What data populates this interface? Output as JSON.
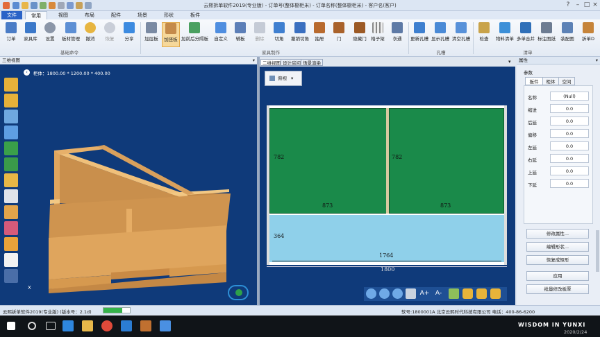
{
  "title": "云熙拆单软件2019(专业版) - 订单号(整体橱柜米) - 订单名称(整体橱柜米) - 客户名(客户)",
  "menu": {
    "tabs": [
      "文件",
      "常用",
      "视图",
      "布局",
      "配件",
      "场景",
      "形状",
      "板件"
    ]
  },
  "ribbon": {
    "buttons": [
      "订单",
      "家具库",
      "设置",
      "板材管理",
      "撤消",
      "恢复",
      "分享",
      "加层板",
      "加竖板",
      "加前后分隔板",
      "自定义",
      "辅板",
      "删除",
      "切角",
      "撤销切角",
      "抽屉",
      "门",
      "隐藏门",
      "格子架",
      "衣通",
      "更新孔槽",
      "显示孔槽",
      "清空孔槽",
      "检查",
      "物料清单",
      "多单合并",
      "标注图纸",
      "装配图",
      "拆单D"
    ],
    "groups": [
      "基础命令",
      "家具制作",
      "孔槽",
      "清单"
    ]
  },
  "panel3d": {
    "title": "三维视图",
    "cabinet_info": "柜体：1800.00 * 1200.00 * 400.00",
    "axis_x": "X"
  },
  "panel2d": {
    "tabs": [
      "二维视图",
      "设计房间",
      "场景渲染"
    ],
    "view_mode": "俯视",
    "dims": {
      "left_height": "782",
      "right_height": "782",
      "left_width": "873",
      "right_width": "873",
      "bottom_height": "364",
      "inner_width": "1764",
      "total_width": "1800"
    }
  },
  "props": {
    "title": "属性",
    "section": "参数",
    "tabs": [
      "板件",
      "柜体",
      "空间"
    ],
    "fields": [
      {
        "label": "名称",
        "value": "(Null)"
      },
      {
        "label": "缩进",
        "value": "0.0"
      },
      {
        "label": "后延",
        "value": "0.0"
      },
      {
        "label": "偏移",
        "value": "0.0"
      },
      {
        "label": "左延",
        "value": "0.0"
      },
      {
        "label": "右延",
        "value": "0.0"
      },
      {
        "label": "上延",
        "value": "0.0"
      },
      {
        "label": "下延",
        "value": "0.0"
      }
    ],
    "buttons": [
      "修改属性...",
      "编辑形状...",
      "恢复成矩形",
      "应用",
      "批量修改板厚"
    ]
  },
  "status": {
    "left": "云熙拆单软件2019(专业版) (版本号：2.1d)",
    "right": "软号:1800001A 北京云熙时代科技有限公司 电话：400-86-6200"
  },
  "taskbar": {
    "date": "2020/2/24",
    "watermark": "WISDOM IN YUNXI"
  },
  "colors": {
    "accent": "#2a63c7",
    "viewport_bg": "#0f3a7a",
    "panel_green": "#1a8a4a",
    "panel_blue": "#8fd0ea"
  }
}
